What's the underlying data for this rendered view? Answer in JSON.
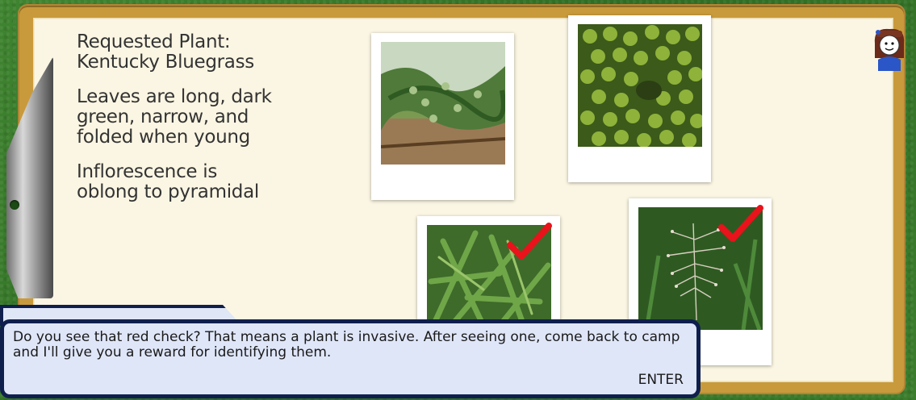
{
  "notes": {
    "requested_label": "Requested Plant:",
    "plant_name": "Kentucky Bluegrass",
    "clue1_lines": [
      "Leaves are long, dark",
      "green, narrow, and",
      "folded when young"
    ],
    "clue2_lines": [
      "Inflorescence is",
      "oblong to pyramidal"
    ]
  },
  "photos": [
    {
      "name": "juniper-shrub",
      "checked": false
    },
    {
      "name": "duckweed",
      "checked": false
    },
    {
      "name": "narrow-leaf-plant",
      "checked": true
    },
    {
      "name": "bluegrass-seedhead",
      "checked": true
    }
  ],
  "dialog": {
    "text": "Do you see that red check?  That means a plant is invasive.  After seeing one, come back to camp and I'll give you a reward for identifying them.",
    "enter_label": "ENTER"
  },
  "colors": {
    "check": "#e8131b",
    "dialog_border": "#0f1f4d",
    "dialog_bg": "#dfe6f8"
  },
  "icons": {
    "check": "red-checkmark-icon",
    "avatar": "player-avatar-icon"
  }
}
